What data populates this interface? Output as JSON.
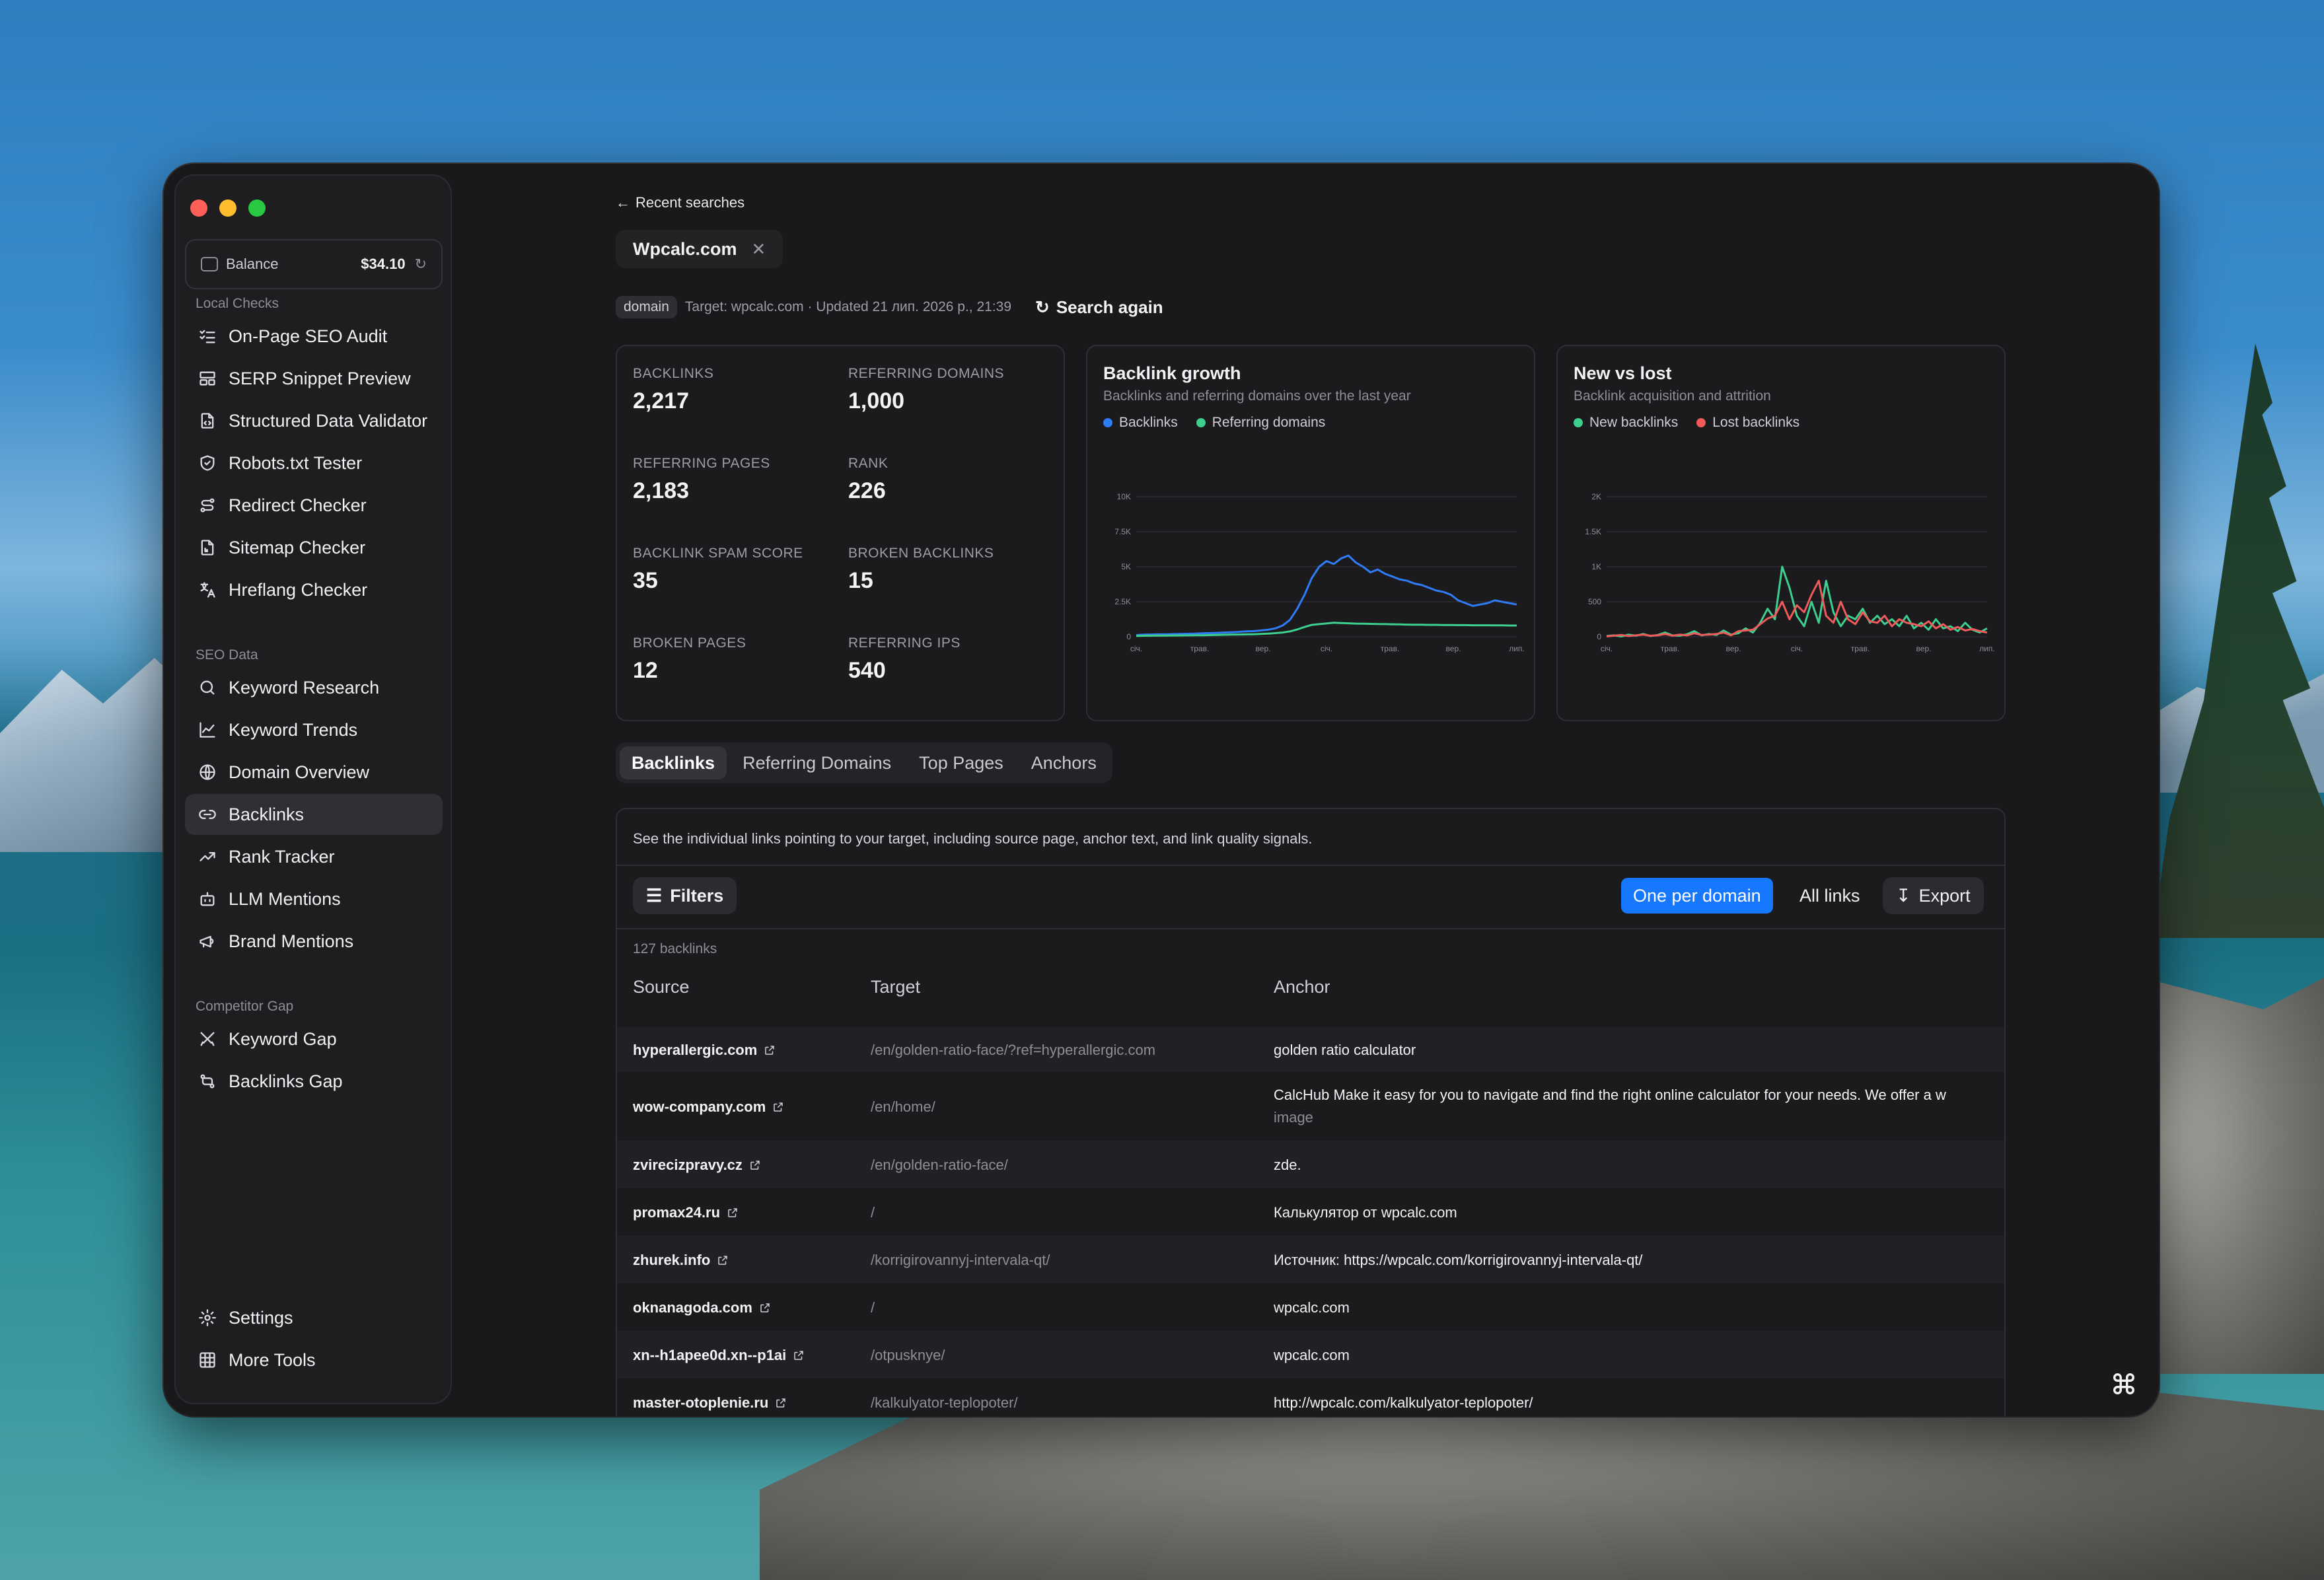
{
  "sidebar": {
    "balance_label": "Balance",
    "balance_amount": "$34.10",
    "sections": [
      {
        "title": "Local Checks",
        "items": [
          {
            "label": "On-Page SEO Audit",
            "icon": "checklist-icon"
          },
          {
            "label": "SERP Snippet Preview",
            "icon": "layout-icon"
          },
          {
            "label": "Structured Data Validator",
            "icon": "file-code-icon"
          },
          {
            "label": "Robots.txt Tester",
            "icon": "shield-check-icon"
          },
          {
            "label": "Redirect Checker",
            "icon": "route-icon"
          },
          {
            "label": "Sitemap Checker",
            "icon": "file-tree-icon"
          },
          {
            "label": "Hreflang Checker",
            "icon": "translate-icon"
          }
        ]
      },
      {
        "title": "SEO Data",
        "items": [
          {
            "label": "Keyword Research",
            "icon": "search-icon"
          },
          {
            "label": "Keyword Trends",
            "icon": "line-chart-icon"
          },
          {
            "label": "Domain Overview",
            "icon": "globe-icon"
          },
          {
            "label": "Backlinks",
            "icon": "link-icon",
            "active": true
          },
          {
            "label": "Rank Tracker",
            "icon": "trending-up-icon"
          },
          {
            "label": "LLM Mentions",
            "icon": "bot-icon"
          },
          {
            "label": "Brand Mentions",
            "icon": "megaphone-icon"
          }
        ]
      },
      {
        "title": "Competitor Gap",
        "items": [
          {
            "label": "Keyword Gap",
            "icon": "crossed-swords-icon"
          },
          {
            "label": "Backlinks Gap",
            "icon": "git-compare-icon"
          }
        ]
      }
    ],
    "footer": [
      {
        "label": "Settings",
        "icon": "gear-icon"
      },
      {
        "label": "More Tools",
        "icon": "grid-icon"
      }
    ]
  },
  "header": {
    "back_label": "Recent searches",
    "domain": "Wpcalc.com",
    "tag": "domain",
    "meta": "Target: wpcalc.com · Updated 21 лип. 2026 р., 21:39",
    "search_again": "Search again"
  },
  "stats": [
    {
      "label": "BACKLINKS",
      "value": "2,217"
    },
    {
      "label": "REFERRING DOMAINS",
      "value": "1,000"
    },
    {
      "label": "REFERRING PAGES",
      "value": "2,183"
    },
    {
      "label": "RANK",
      "value": "226"
    },
    {
      "label": "BACKLINK SPAM SCORE",
      "value": "35"
    },
    {
      "label": "BROKEN BACKLINKS",
      "value": "15"
    },
    {
      "label": "BROKEN PAGES",
      "value": "12"
    },
    {
      "label": "REFERRING IPS",
      "value": "540"
    }
  ],
  "charts": {
    "growth": {
      "title": "Backlink growth",
      "subtitle": "Backlinks and referring domains over the last year"
    },
    "newlost": {
      "title": "New vs lost",
      "subtitle": "Backlink acquisition and attrition"
    }
  },
  "chart_data": [
    {
      "type": "line",
      "title": "Backlink growth",
      "x_ticks": [
        "січ.",
        "трав.",
        "вер.",
        "січ.",
        "трав.",
        "вер.",
        "лип."
      ],
      "y_ticks": [
        "0",
        "2.5K",
        "5K",
        "7.5K",
        "10K"
      ],
      "ylim": [
        0,
        10000
      ],
      "grid": true,
      "legend_position": "top-left",
      "series": [
        {
          "name": "Backlinks",
          "color": "#2f7cf6",
          "values": [
            120,
            150,
            160,
            180,
            170,
            190,
            200,
            210,
            220,
            250,
            260,
            280,
            300,
            320,
            350,
            380,
            400,
            450,
            500,
            600,
            800,
            1200,
            2000,
            3000,
            4200,
            5000,
            5400,
            5200,
            5600,
            5800,
            5300,
            5000,
            4600,
            4800,
            4500,
            4300,
            4100,
            4000,
            3800,
            3700,
            3500,
            3300,
            3200,
            3000,
            2600,
            2400,
            2200,
            2300,
            2400,
            2600,
            2500,
            2400,
            2300
          ]
        },
        {
          "name": "Referring domains",
          "color": "#3ccf8e",
          "values": [
            60,
            70,
            75,
            80,
            85,
            90,
            95,
            100,
            105,
            110,
            120,
            130,
            140,
            150,
            160,
            170,
            180,
            200,
            220,
            260,
            300,
            380,
            520,
            700,
            850,
            900,
            950,
            1000,
            980,
            960,
            940,
            930,
            920,
            910,
            900,
            890,
            880,
            870,
            860,
            860,
            850,
            850,
            840,
            840,
            830,
            830,
            820,
            820,
            820,
            810,
            810,
            800,
            800
          ]
        }
      ]
    },
    {
      "type": "line",
      "title": "New vs lost",
      "x_ticks": [
        "січ.",
        "трав.",
        "вер.",
        "січ.",
        "трав.",
        "вер.",
        "лип."
      ],
      "y_ticks": [
        "0",
        "500",
        "1K",
        "1.5K",
        "2K"
      ],
      "ylim": [
        0,
        2000
      ],
      "grid": true,
      "legend_position": "top-left",
      "series": [
        {
          "name": "New backlinks",
          "color": "#3ccf8e",
          "values": [
            10,
            20,
            5,
            30,
            15,
            40,
            10,
            25,
            60,
            20,
            15,
            35,
            80,
            20,
            40,
            25,
            90,
            30,
            50,
            120,
            60,
            200,
            400,
            250,
            1000,
            700,
            300,
            150,
            500,
            200,
            800,
            350,
            150,
            300,
            250,
            400,
            200,
            300,
            180,
            250,
            150,
            300,
            120,
            200,
            100,
            250,
            120,
            150,
            80,
            200,
            100,
            60,
            120
          ]
        },
        {
          "name": "Lost backlinks",
          "color": "#f05a5a",
          "values": [
            5,
            15,
            25,
            10,
            20,
            30,
            15,
            20,
            40,
            15,
            30,
            20,
            50,
            25,
            30,
            40,
            60,
            20,
            80,
            90,
            100,
            180,
            260,
            300,
            500,
            250,
            450,
            350,
            600,
            800,
            300,
            200,
            500,
            250,
            180,
            350,
            220,
            200,
            300,
            150,
            250,
            200,
            180,
            150,
            220,
            120,
            180,
            100,
            140,
            90,
            110,
            80,
            60
          ]
        }
      ]
    }
  ],
  "tabs": [
    "Backlinks",
    "Referring Domains",
    "Top Pages",
    "Anchors"
  ],
  "table": {
    "description": "See the individual links pointing to your target, including source page, anchor text, and link quality signals.",
    "filters_label": "Filters",
    "one_per_domain": "One per domain",
    "all_links": "All links",
    "export": "Export",
    "count": "127 backlinks",
    "columns": [
      "Source",
      "Target",
      "Anchor"
    ],
    "rows": [
      {
        "source": "hyperallergic.com",
        "target": "/en/golden-ratio-face/?ref=hyperallergic.com",
        "anchor": "golden ratio calculator",
        "anchor2": ""
      },
      {
        "source": "wow-company.com",
        "target": "/en/home/",
        "anchor": "CalcHub Make it easy for you to navigate and find the right online calculator for your needs. We offer a w",
        "anchor2": "image"
      },
      {
        "source": "zvirecizpravy.cz",
        "target": "/en/golden-ratio-face/",
        "anchor": "zde.",
        "anchor2": ""
      },
      {
        "source": "promax24.ru",
        "target": "/",
        "anchor": "Калькулятор от wpcalc.com",
        "anchor2": ""
      },
      {
        "source": "zhurek.info",
        "target": "/korrigirovannyj-intervala-qt/",
        "anchor": "Источник: https://wpcalc.com/korrigirovannyj-intervala-qt/",
        "anchor2": ""
      },
      {
        "source": "oknanagoda.com",
        "target": "/",
        "anchor": "wpcalc.com",
        "anchor2": ""
      },
      {
        "source": "xn--h1apee0d.xn--p1ai",
        "target": "/otpusknye/",
        "anchor": "wpcalc.com",
        "anchor2": ""
      },
      {
        "source": "master-otoplenie.ru",
        "target": "/kalkulyator-teplopoter/",
        "anchor": "http://wpcalc.com/kalkulyator-teplopoter/",
        "anchor2": ""
      }
    ]
  }
}
